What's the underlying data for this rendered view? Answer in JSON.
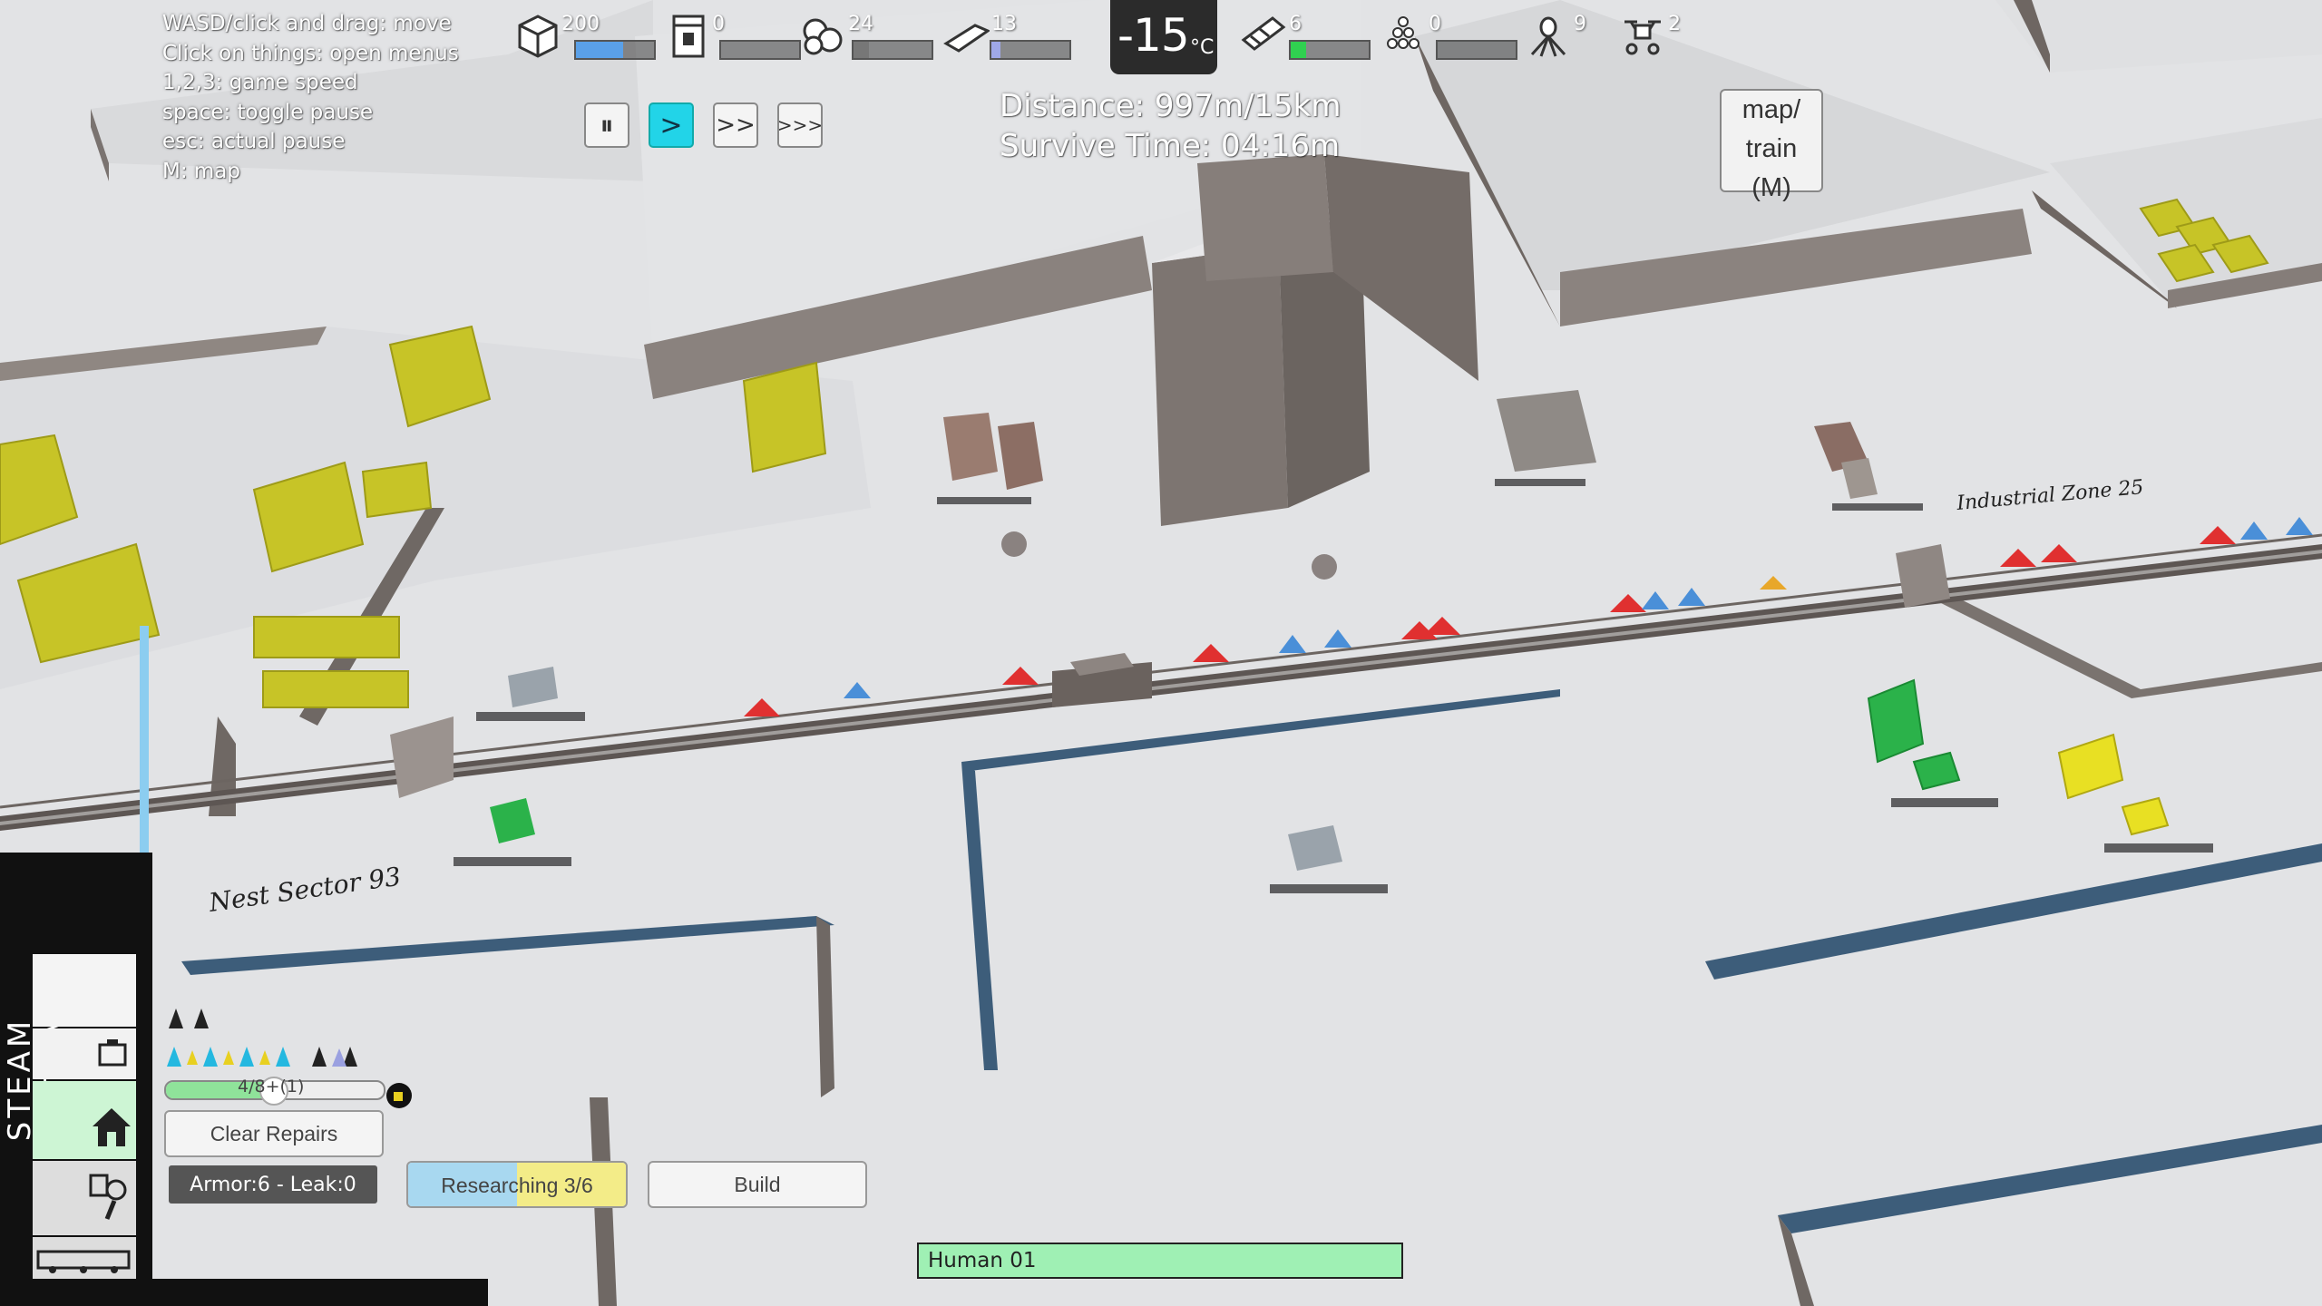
{
  "help": {
    "lines": [
      "WASD/click and drag: move",
      "Click on things: open menus",
      "1,2,3: game speed",
      "space: toggle pause",
      "esc: actual pause",
      "M: map"
    ]
  },
  "resources": [
    {
      "icon": "crate-icon",
      "value": "200",
      "fill": 0.6,
      "color": "#5aa0e8"
    },
    {
      "icon": "canister-icon",
      "value": "0",
      "fill": 0.0,
      "color": "#888888"
    },
    {
      "icon": "ore-icon",
      "value": "24",
      "fill": 0.2,
      "color": "#777777"
    },
    {
      "icon": "ingot-icon",
      "value": "13",
      "fill": 0.12,
      "color": "#9fa8e8"
    },
    {
      "icon": "rail-icon",
      "value": "6",
      "fill": 0.2,
      "color": "#30d050"
    },
    {
      "icon": "pyramid-icon",
      "value": "0",
      "fill": 0.0,
      "color": "#888888"
    },
    {
      "icon": "bug-icon",
      "value": "9"
    },
    {
      "icon": "drone-icon",
      "value": "2"
    }
  ],
  "temperature": {
    "value": "-15",
    "unit": "°C"
  },
  "speed_controls": [
    {
      "label": "⏸",
      "name": "pause-button",
      "active": false
    },
    {
      "label": ">",
      "name": "speed-1-button",
      "active": true
    },
    {
      "label": ">>",
      "name": "speed-2-button",
      "active": false
    },
    {
      "label": ">>>",
      "name": "speed-3-button",
      "active": false
    }
  ],
  "journey": {
    "distance": "Distance: 997m/15km",
    "survive": "Survive Time: 04:16m"
  },
  "map_button": {
    "line1": "map/",
    "line2": "train",
    "line3": "(M)"
  },
  "zones": {
    "industrial": "Industrial Zone 25",
    "nest": "Nest Sector 93"
  },
  "sidebar": {
    "title": "STEAM SYSTEM"
  },
  "crew": {
    "progress_label": "4/8+(1)",
    "progress_fill": 0.48
  },
  "buttons": {
    "clear_repairs": "Clear Repairs",
    "armor": "Armor:6 - Leak:0",
    "research": "Researching 3/6",
    "build": "Build"
  },
  "selected": {
    "name": "Human 01"
  }
}
